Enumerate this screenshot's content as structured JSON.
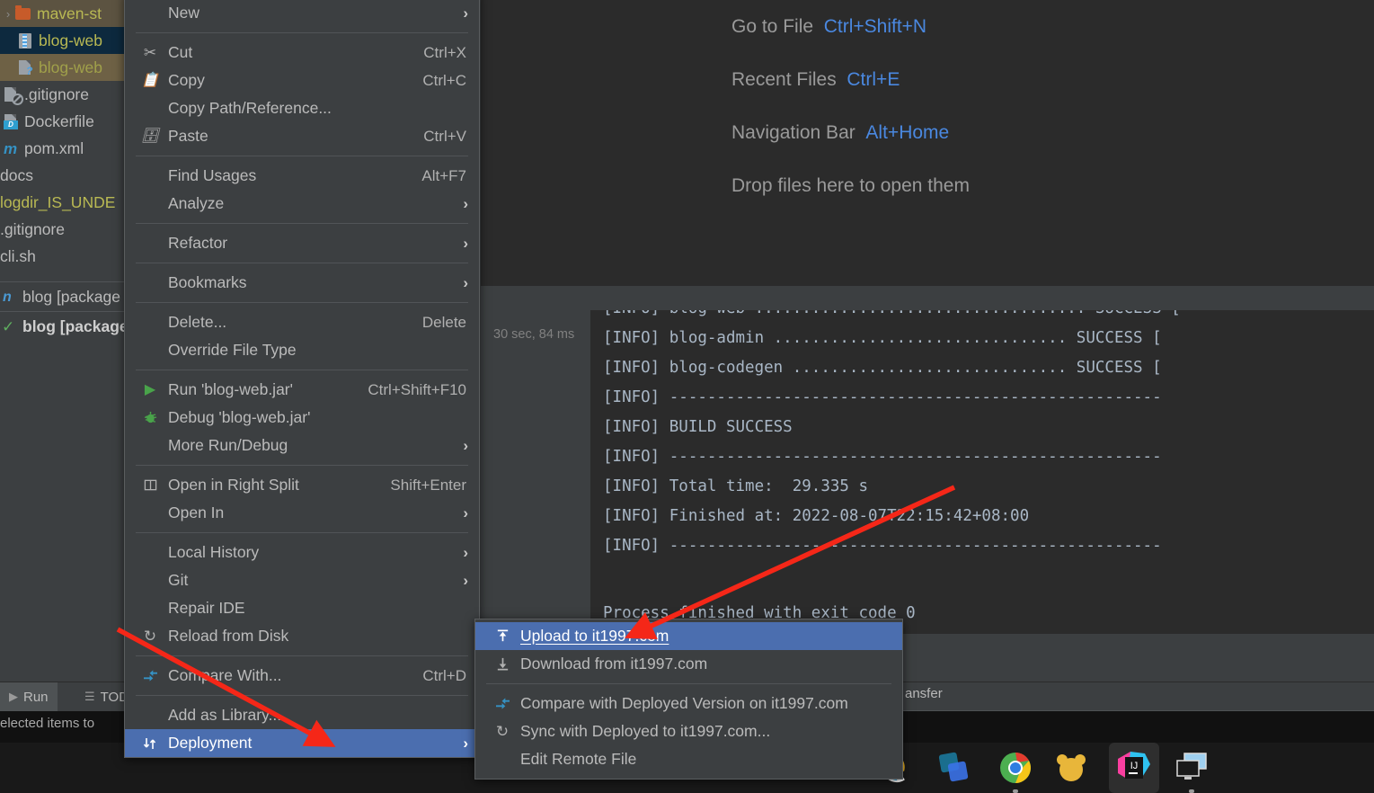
{
  "project_tree": {
    "rows": [
      {
        "label": "maven-st",
        "icon": "folder-icon",
        "color": "yellow",
        "indent": 0,
        "twisty": "›",
        "state": "olive-bg"
      },
      {
        "label": "blog-web",
        "icon": "jar-icon",
        "color": "yellow",
        "indent": 1,
        "twisty": "",
        "state": "selected-blue"
      },
      {
        "label": "blog-web",
        "icon": "file-question-icon",
        "color": "yellowdim",
        "indent": 1,
        "twisty": "",
        "state": "selected-olive"
      },
      {
        "label": ".gitignore",
        "icon": "gitignore-icon",
        "color": "white",
        "indent": 0,
        "twisty": "",
        "state": ""
      },
      {
        "label": "Dockerfile",
        "icon": "dockerfile-icon",
        "color": "white",
        "indent": 0,
        "twisty": "",
        "state": ""
      },
      {
        "label": "pom.xml",
        "icon": "maven-icon",
        "color": "white",
        "indent": 0,
        "twisty": "",
        "state": ""
      },
      {
        "label": "docs",
        "icon": "",
        "color": "white",
        "indent": 0,
        "twisty": "",
        "state": ""
      },
      {
        "label": "logdir_IS_UNDE",
        "icon": "",
        "color": "yellow",
        "indent": 0,
        "twisty": "",
        "state": ""
      },
      {
        "label": ".gitignore",
        "icon": "",
        "color": "white",
        "indent": 0,
        "twisty": "",
        "state": ""
      },
      {
        "label": "cli.sh",
        "icon": "",
        "color": "white",
        "indent": 0,
        "twisty": "",
        "state": ""
      }
    ],
    "bottom_rows": [
      {
        "label": "blog [package",
        "icon": "package-icon",
        "bold": false
      },
      {
        "label": "blog [package",
        "icon": "check-icon",
        "bold": true
      }
    ]
  },
  "editor_hints": {
    "rows": [
      {
        "label": "Go to File",
        "shortcut": "Ctrl+Shift+N"
      },
      {
        "label": "Recent Files",
        "shortcut": "Ctrl+E"
      },
      {
        "label": "Navigation Bar",
        "shortcut": "Alt+Home"
      }
    ],
    "drop_text": "Drop files here to open them"
  },
  "build": {
    "elapsed": "30 sec, 84 ms",
    "console_lines": [
      "[INFO] blog-web ................................... SUCCESS [",
      "[INFO] blog-admin ............................... SUCCESS [",
      "[INFO] blog-codegen ............................. SUCCESS [",
      "[INFO] ----------------------------------------------------",
      "[INFO] BUILD SUCCESS",
      "[INFO] ----------------------------------------------------",
      "[INFO] Total time:  29.335 s",
      "[INFO] Finished at: 2022-08-07T22:15:42+08:00",
      "[INFO] ----------------------------------------------------"
    ],
    "exit_line": "Process finished with exit code 0"
  },
  "bottom_bar": {
    "run_tab": "Run",
    "todo_tab": "TOD",
    "status_text": "elected items to",
    "transfer_tab": "ansfer"
  },
  "context_menu": {
    "items": [
      {
        "label": "New",
        "icon": "",
        "key": "",
        "arrow": true,
        "mnemonic": ""
      },
      {
        "sep": true
      },
      {
        "label": "Cut",
        "icon": "scissors-icon",
        "key": "Ctrl+X",
        "arrow": false,
        "mnemonic": "t"
      },
      {
        "label": "Copy",
        "icon": "copy-icon",
        "key": "Ctrl+C",
        "arrow": false,
        "mnemonic": "C"
      },
      {
        "label": "Copy Path/Reference...",
        "icon": "",
        "key": "",
        "arrow": false,
        "mnemonic": ""
      },
      {
        "label": "Paste",
        "icon": "paste-icon",
        "key": "Ctrl+V",
        "arrow": false,
        "mnemonic": "P"
      },
      {
        "sep": true
      },
      {
        "label": "Find Usages",
        "icon": "",
        "key": "Alt+F7",
        "arrow": false,
        "mnemonic": "U"
      },
      {
        "label": "Analyze",
        "icon": "",
        "key": "",
        "arrow": true,
        "mnemonic": "z"
      },
      {
        "sep": true
      },
      {
        "label": "Refactor",
        "icon": "",
        "key": "",
        "arrow": true,
        "mnemonic": "R"
      },
      {
        "sep": true
      },
      {
        "label": "Bookmarks",
        "icon": "",
        "key": "",
        "arrow": true,
        "mnemonic": ""
      },
      {
        "sep": true
      },
      {
        "label": "Delete...",
        "icon": "",
        "key": "Delete",
        "arrow": false,
        "mnemonic": "D"
      },
      {
        "label": "Override File Type",
        "icon": "",
        "key": "",
        "arrow": false,
        "mnemonic": ""
      },
      {
        "sep": true
      },
      {
        "label": "Run 'blog-web.jar'",
        "icon": "run-icon",
        "key": "Ctrl+Shift+F10",
        "arrow": false,
        "mnemonic": "u"
      },
      {
        "label": "Debug 'blog-web.jar'",
        "icon": "debug-icon",
        "key": "",
        "arrow": false,
        "mnemonic": "D"
      },
      {
        "label": "More Run/Debug",
        "icon": "",
        "key": "",
        "arrow": true,
        "mnemonic": ""
      },
      {
        "sep": true
      },
      {
        "label": "Open in Right Split",
        "icon": "split-icon",
        "key": "Shift+Enter",
        "arrow": false,
        "mnemonic": ""
      },
      {
        "label": "Open In",
        "icon": "",
        "key": "",
        "arrow": true,
        "mnemonic": ""
      },
      {
        "sep": true
      },
      {
        "label": "Local History",
        "icon": "",
        "key": "",
        "arrow": true,
        "mnemonic": "H"
      },
      {
        "label": "Git",
        "icon": "",
        "key": "",
        "arrow": true,
        "mnemonic": "G"
      },
      {
        "label": "Repair IDE",
        "icon": "",
        "key": "",
        "arrow": false,
        "mnemonic": ""
      },
      {
        "label": "Reload from Disk",
        "icon": "reload-icon",
        "key": "",
        "arrow": false,
        "mnemonic": ""
      },
      {
        "sep": true
      },
      {
        "label": "Compare With...",
        "icon": "compare-icon",
        "key": "Ctrl+D",
        "arrow": false,
        "mnemonic": "p"
      },
      {
        "sep": true
      },
      {
        "label": "Add as Library...",
        "icon": "",
        "key": "",
        "arrow": false,
        "mnemonic": ""
      },
      {
        "label": "Deployment",
        "icon": "deployment-icon",
        "key": "",
        "arrow": true,
        "highlight": true,
        "mnemonic": ""
      }
    ]
  },
  "submenu": {
    "items": [
      {
        "label": "Upload to it1997.com",
        "icon": "upload-icon",
        "highlight": true,
        "mnemonic": "U"
      },
      {
        "label": "Download from it1997.com",
        "icon": "download-icon",
        "highlight": false,
        "mnemonic": "D"
      },
      {
        "sep": true
      },
      {
        "label": "Compare with Deployed Version on it1997.com",
        "icon": "compare-icon",
        "highlight": false,
        "mnemonic": "C"
      },
      {
        "label": "Sync with Deployed to it1997.com...",
        "icon": "sync-icon",
        "highlight": false,
        "mnemonic": "S"
      },
      {
        "label": "Edit Remote File",
        "icon": "",
        "highlight": false,
        "mnemonic": "m"
      }
    ]
  },
  "colors": {
    "menu_bg": "#3c3f41",
    "menu_highlight": "#4b6eaf",
    "editor_bg": "#2b2b2b",
    "accent_blue": "#4a88e0",
    "annotation_red": "#f52718",
    "tree_yellow": "#b9b953",
    "console_text": "#a9b7c6"
  },
  "taskbar": {
    "icons": [
      "partial-circle-icon",
      "teams-icon",
      "chrome-icon",
      "bear-icon",
      "intellij-idea-icon",
      "remote-desktop-icon"
    ]
  }
}
